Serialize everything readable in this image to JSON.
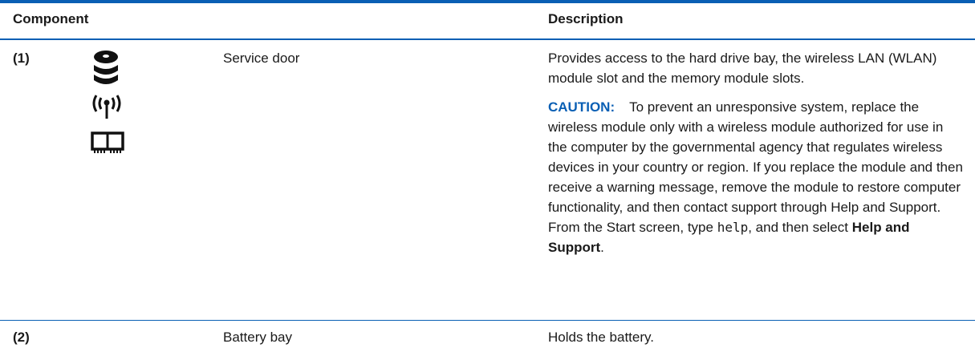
{
  "table": {
    "headers": {
      "component": "Component",
      "description": "Description"
    },
    "rows": [
      {
        "number": "(1)",
        "name": "Service door",
        "icons": [
          "hard-drive-icon",
          "wireless-antenna-icon",
          "memory-module-icon"
        ],
        "description": "Provides access to the hard drive bay, the wireless LAN (WLAN) module slot and the memory module slots.",
        "caution": {
          "label": "CAUTION:",
          "text": "To prevent an unresponsive system, replace the wireless module only with a wireless module authorized for use in the computer by the governmental agency that regulates wireless devices in your country or region. If you replace the module and then receive a warning message, remove the module to restore computer functionality, and then contact support through Help and Support. From the Start screen, type",
          "code": "help",
          "mid": ", and then select",
          "bold": "Help and Support",
          "end": "."
        }
      },
      {
        "number": "(2)",
        "name": "Battery bay",
        "description": "Holds the battery."
      }
    ]
  },
  "colors": {
    "accent": "#0a5fb4",
    "text": "#1a1a1a"
  }
}
